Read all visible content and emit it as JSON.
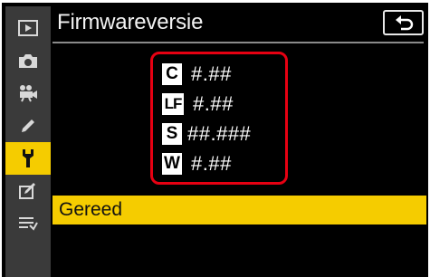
{
  "screen": {
    "title": "Firmwareversie",
    "back_icon": "return-arrow-icon",
    "accent_color": "#f5cc00",
    "highlight_color": "#e60012"
  },
  "sidebar": {
    "items": [
      {
        "icon": "playback-icon",
        "active": false
      },
      {
        "icon": "camera-icon",
        "active": false
      },
      {
        "icon": "movie-camera-icon",
        "active": false
      },
      {
        "icon": "pencil-icon",
        "active": false
      },
      {
        "icon": "wrench-icon",
        "active": true
      },
      {
        "icon": "retouch-icon",
        "active": false
      },
      {
        "icon": "my-menu-icon",
        "active": false
      }
    ]
  },
  "firmware": {
    "rows": [
      {
        "badge": "C",
        "version": "#.##"
      },
      {
        "badge": "LF",
        "version": "#.##"
      },
      {
        "badge": "S",
        "version": "##.###"
      },
      {
        "badge": "W",
        "version": "#.##"
      }
    ]
  },
  "done": {
    "label": "Gereed"
  }
}
